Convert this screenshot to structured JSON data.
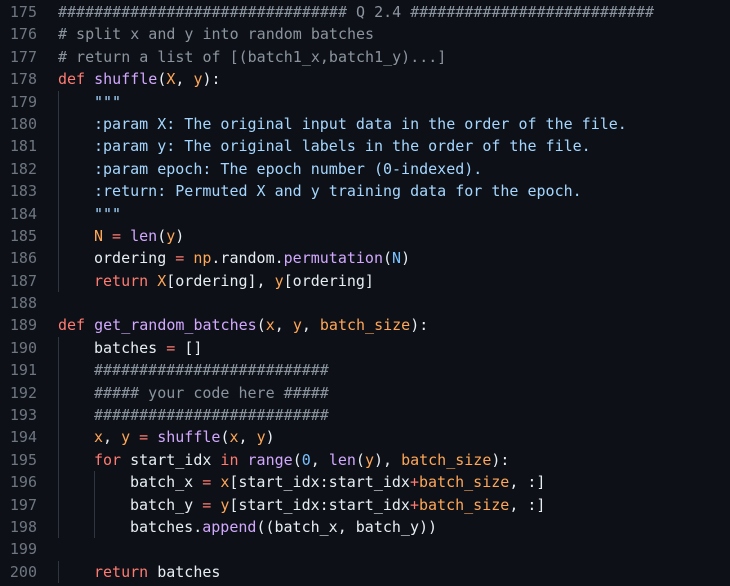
{
  "editor": {
    "lines": [
      {
        "num": "175",
        "indent": 0,
        "tokens": [
          {
            "t": "################################ Q 2.4 ###########################",
            "c": "cmt"
          }
        ]
      },
      {
        "num": "176",
        "indent": 0,
        "tokens": [
          {
            "t": "# split x and y into random batches",
            "c": "cmt"
          }
        ]
      },
      {
        "num": "177",
        "indent": 0,
        "tokens": [
          {
            "t": "# return a list of [(batch1_x,batch1_y)...]",
            "c": "cmt"
          }
        ]
      },
      {
        "num": "178",
        "indent": 0,
        "tokens": [
          {
            "t": "def ",
            "c": "kw"
          },
          {
            "t": "shuffle",
            "c": "fn"
          },
          {
            "t": "(",
            "c": "p"
          },
          {
            "t": "X",
            "c": "var"
          },
          {
            "t": ", ",
            "c": "p"
          },
          {
            "t": "y",
            "c": "var"
          },
          {
            "t": "):",
            "c": "p"
          }
        ]
      },
      {
        "num": "179",
        "indent": 1,
        "tokens": [
          {
            "t": "\"\"\"",
            "c": "str"
          }
        ]
      },
      {
        "num": "180",
        "indent": 1,
        "tokens": [
          {
            "t": ":param X: The original input data in the order of the file.",
            "c": "str"
          }
        ]
      },
      {
        "num": "181",
        "indent": 1,
        "tokens": [
          {
            "t": ":param y: The original labels in the order of the file.",
            "c": "str"
          }
        ]
      },
      {
        "num": "182",
        "indent": 1,
        "tokens": [
          {
            "t": ":param epoch: The epoch number (0-indexed).",
            "c": "str"
          }
        ]
      },
      {
        "num": "183",
        "indent": 1,
        "tokens": [
          {
            "t": ":return: Permuted X and y training data for the epoch.",
            "c": "str"
          }
        ]
      },
      {
        "num": "184",
        "indent": 1,
        "tokens": [
          {
            "t": "\"\"\"",
            "c": "str"
          }
        ]
      },
      {
        "num": "185",
        "indent": 1,
        "tokens": [
          {
            "t": "N",
            "c": "var"
          },
          {
            "t": " = ",
            "c": "op"
          },
          {
            "t": "len",
            "c": "fn"
          },
          {
            "t": "(",
            "c": "p"
          },
          {
            "t": "y",
            "c": "var"
          },
          {
            "t": ")",
            "c": "p"
          }
        ]
      },
      {
        "num": "186",
        "indent": 1,
        "tokens": [
          {
            "t": "ordering",
            "c": "p"
          },
          {
            "t": " = ",
            "c": "op"
          },
          {
            "t": "np",
            "c": "var"
          },
          {
            "t": ".random.",
            "c": "p"
          },
          {
            "t": "permutation",
            "c": "fn"
          },
          {
            "t": "(",
            "c": "p"
          },
          {
            "t": "N",
            "c": "num"
          },
          {
            "t": ")",
            "c": "p"
          }
        ]
      },
      {
        "num": "187",
        "indent": 1,
        "tokens": [
          {
            "t": "return ",
            "c": "kw"
          },
          {
            "t": "X",
            "c": "var"
          },
          {
            "t": "[ordering], ",
            "c": "p"
          },
          {
            "t": "y",
            "c": "var"
          },
          {
            "t": "[ordering]",
            "c": "p"
          }
        ]
      },
      {
        "num": "188",
        "indent": 0,
        "tokens": []
      },
      {
        "num": "189",
        "indent": 0,
        "tokens": [
          {
            "t": "def ",
            "c": "kw"
          },
          {
            "t": "get_random_batches",
            "c": "fn"
          },
          {
            "t": "(",
            "c": "p"
          },
          {
            "t": "x",
            "c": "var"
          },
          {
            "t": ", ",
            "c": "p"
          },
          {
            "t": "y",
            "c": "var"
          },
          {
            "t": ", ",
            "c": "p"
          },
          {
            "t": "batch_size",
            "c": "var"
          },
          {
            "t": "):",
            "c": "p"
          }
        ]
      },
      {
        "num": "190",
        "indent": 1,
        "tokens": [
          {
            "t": "batches",
            "c": "p"
          },
          {
            "t": " = ",
            "c": "op"
          },
          {
            "t": "[]",
            "c": "p"
          }
        ]
      },
      {
        "num": "191",
        "indent": 1,
        "tokens": [
          {
            "t": "##########################",
            "c": "cmt"
          }
        ]
      },
      {
        "num": "192",
        "indent": 1,
        "tokens": [
          {
            "t": "##### your code here #####",
            "c": "cmt"
          }
        ]
      },
      {
        "num": "193",
        "indent": 1,
        "tokens": [
          {
            "t": "##########################",
            "c": "cmt"
          }
        ]
      },
      {
        "num": "194",
        "indent": 1,
        "tokens": [
          {
            "t": "x",
            "c": "var"
          },
          {
            "t": ", ",
            "c": "p"
          },
          {
            "t": "y",
            "c": "var"
          },
          {
            "t": " = ",
            "c": "op"
          },
          {
            "t": "shuffle",
            "c": "fn"
          },
          {
            "t": "(",
            "c": "p"
          },
          {
            "t": "x",
            "c": "var"
          },
          {
            "t": ", ",
            "c": "p"
          },
          {
            "t": "y",
            "c": "var"
          },
          {
            "t": ")",
            "c": "p"
          }
        ]
      },
      {
        "num": "195",
        "indent": 1,
        "tokens": [
          {
            "t": "for ",
            "c": "kw"
          },
          {
            "t": "start_idx",
            "c": "p"
          },
          {
            "t": " in ",
            "c": "kw"
          },
          {
            "t": "range",
            "c": "fn"
          },
          {
            "t": "(",
            "c": "p"
          },
          {
            "t": "0",
            "c": "num"
          },
          {
            "t": ", ",
            "c": "p"
          },
          {
            "t": "len",
            "c": "fn"
          },
          {
            "t": "(",
            "c": "p"
          },
          {
            "t": "y",
            "c": "var"
          },
          {
            "t": "), ",
            "c": "p"
          },
          {
            "t": "batch_size",
            "c": "var"
          },
          {
            "t": "):",
            "c": "p"
          }
        ]
      },
      {
        "num": "196",
        "indent": 2,
        "tokens": [
          {
            "t": "batch_x",
            "c": "p"
          },
          {
            "t": " = ",
            "c": "op"
          },
          {
            "t": "x",
            "c": "var"
          },
          {
            "t": "[start_idx:start_idx",
            "c": "p"
          },
          {
            "t": "+",
            "c": "op"
          },
          {
            "t": "batch_size",
            "c": "var"
          },
          {
            "t": ", :]",
            "c": "p"
          }
        ]
      },
      {
        "num": "197",
        "indent": 2,
        "tokens": [
          {
            "t": "batch_y",
            "c": "p"
          },
          {
            "t": " = ",
            "c": "op"
          },
          {
            "t": "y",
            "c": "var"
          },
          {
            "t": "[start_idx:start_idx",
            "c": "p"
          },
          {
            "t": "+",
            "c": "op"
          },
          {
            "t": "batch_size",
            "c": "var"
          },
          {
            "t": ", :]",
            "c": "p"
          }
        ]
      },
      {
        "num": "198",
        "indent": 2,
        "tokens": [
          {
            "t": "batches.",
            "c": "p"
          },
          {
            "t": "append",
            "c": "fn"
          },
          {
            "t": "((batch_x, batch_y))",
            "c": "p"
          }
        ]
      },
      {
        "num": "199",
        "indent": 0,
        "tokens": []
      },
      {
        "num": "200",
        "indent": 1,
        "tokens": [
          {
            "t": "return ",
            "c": "kw"
          },
          {
            "t": "batches",
            "c": "p"
          }
        ]
      }
    ]
  },
  "colors": {
    "background": "#0d1117",
    "line_number": "#6e7681",
    "keyword": "#ff7b72",
    "function": "#d2a8ff",
    "string": "#a5d6ff",
    "comment": "#8b949e",
    "number": "#79c0ff",
    "variable": "#ffa657",
    "text": "#e6edf3"
  }
}
